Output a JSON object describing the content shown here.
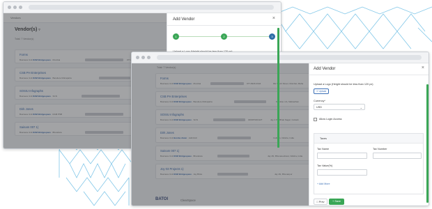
{
  "back_window": {
    "topbar_text": "Vendors",
    "title": "Vendor(s)",
    "subtitle": "Total: 7 Vendor(s)",
    "drawer": {
      "title": "Add Vendor",
      "steps": [
        "1",
        "2",
        "3"
      ],
      "upload_label": "Upload a Logo (Height should be less than 120 px)"
    },
    "vendors": [
      {
        "name": "Forms",
        "meta_prefix": "Business Unit",
        "unit": "RAM Bridgespace",
        "city": "Mumbai",
        "phone": "077-8326-3344"
      },
      {
        "name": "CSB PH Enterprises",
        "meta_prefix": "Business Unit",
        "unit": "RAM Bridgespace",
        "city": "Bareilere Mohapatra",
        "phone": ""
      },
      {
        "name": "SOSIU Infographs",
        "meta_prefix": "Business Unit",
        "unit": "RAM Bridgespace",
        "city": "SCN",
        "phone": ""
      },
      {
        "name": "Dirk Jones",
        "meta_prefix": "Business Unit",
        "unit": "RAM Bridgespace",
        "city": "RAM PSB",
        "phone": ""
      },
      {
        "name": "Sainam 007 1)",
        "meta_prefix": "Business Unit",
        "unit": "RAM Bridgespace",
        "city": "Bhandara",
        "phone": ""
      }
    ]
  },
  "front_window": {
    "subtitle": "Total: 7 Vendor(s)",
    "vendors": [
      {
        "name": "Forms",
        "meta_prefix": "Business Unit",
        "unit": "RAM Bridgespace",
        "city": "Mumbai",
        "right": "077-8326-3344",
        "right2": "DE South Street, Mumbai, Maha"
      },
      {
        "name": "CSB PH Enterprises",
        "meta_prefix": "Business Unit",
        "unit": "RAM Bridgespace",
        "city": "Bareilere Mohapatra",
        "right": "",
        "right2": "Mumbai, CA, Mahasthan"
      },
      {
        "name": "SOSIU Infographs",
        "meta_prefix": "Business Unit",
        "unit": "RAM Bridgespace",
        "city": "SCN",
        "right": "3000PNDO42T",
        "right2": "Jay 4 Pk, Bhati Nagar, Cuttack"
      },
      {
        "name": "Dirk Jones",
        "meta_prefix": "Business Unit",
        "unit": "Bombe Alwar",
        "city": "Aditi Roll",
        "right": "",
        "right2": "Culburn, Odisha, India"
      },
      {
        "name": "Sainam 007 1)",
        "meta_prefix": "Business Unit",
        "unit": "RAM Bridgespace",
        "city": "Bhandara",
        "right": "",
        "right2": "Jay 4N, Bhuvaneshwar, Odisha, India"
      },
      {
        "name": "Joy 03 Projects 1)",
        "meta_prefix": "Business Unit",
        "unit": "RAM Bridgespace",
        "city": "Jay Bhira",
        "right": "",
        "right2": "Jay 4N, Bhuvanpur"
      }
    ],
    "footer_logos": {
      "batoi": "BATOI",
      "clearspace": "ClearSpace"
    },
    "drawer": {
      "title": "Add Vendor",
      "close": "×",
      "upload_label": "Upload a Logo (Height should be less than 120 px)",
      "upload_button": "Upload",
      "currency_label": "Currency*",
      "currency_value": "USD",
      "allow_login_label": "Allow Login Access",
      "taxes_title": "Taxes",
      "tax_name_label": "Tax Name",
      "tax_number_label": "Tax Number",
      "tax_value_label": "Tax Value(%)",
      "add_more": "+ Add More",
      "prev_button": "Prev",
      "save_button": "Save"
    }
  },
  "colors": {
    "accent_blue": "#2c5fa8",
    "step_green": "#3aa656",
    "step_active": "#2f6ea8",
    "mesh": "#7fc6e8"
  }
}
